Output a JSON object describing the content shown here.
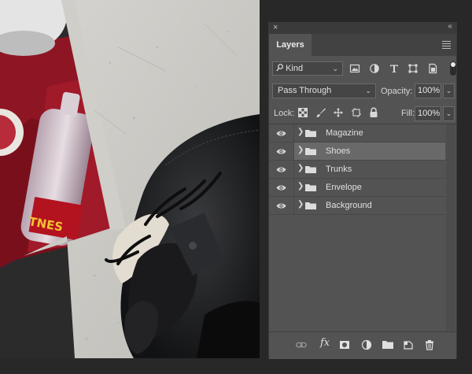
{
  "panel": {
    "close_glyph": "×",
    "collapse_glyph": "‹‹",
    "tab_label": "Layers",
    "menu_icon": "panel-menu-icon"
  },
  "filter": {
    "kind_label": "Kind",
    "kind_chevron": "⌄",
    "icons": [
      "image-filter-icon",
      "adjustment-filter-icon",
      "type-filter-icon",
      "shape-filter-icon",
      "smartobject-filter-icon"
    ],
    "toggle_on": true
  },
  "blend": {
    "mode": "Pass Through",
    "opacity_label": "Opacity:",
    "opacity_value": "100%",
    "chevron": "⌄"
  },
  "lock": {
    "label": "Lock:",
    "icons": [
      "lock-transparency-icon",
      "lock-image-icon",
      "lock-position-icon",
      "lock-artboard-icon",
      "lock-all-icon"
    ],
    "fill_label": "Fill:",
    "fill_value": "100%"
  },
  "layers": [
    {
      "name": "Magazine",
      "visible": true,
      "selected": false
    },
    {
      "name": "Shoes",
      "visible": true,
      "selected": true
    },
    {
      "name": "Trunks",
      "visible": true,
      "selected": false
    },
    {
      "name": "Envelope",
      "visible": true,
      "selected": false
    },
    {
      "name": "Background",
      "visible": true,
      "selected": false
    }
  ],
  "bottom_bar": {
    "fx_label": "fx",
    "icons": [
      "link-layers-icon",
      "add-style-icon",
      "add-mask-icon",
      "new-adjustment-icon",
      "new-group-icon",
      "new-layer-icon",
      "delete-layer-icon"
    ]
  },
  "colors": {
    "panel_bg": "#535353",
    "selected_row": "#696969",
    "app_bg": "#282828"
  }
}
